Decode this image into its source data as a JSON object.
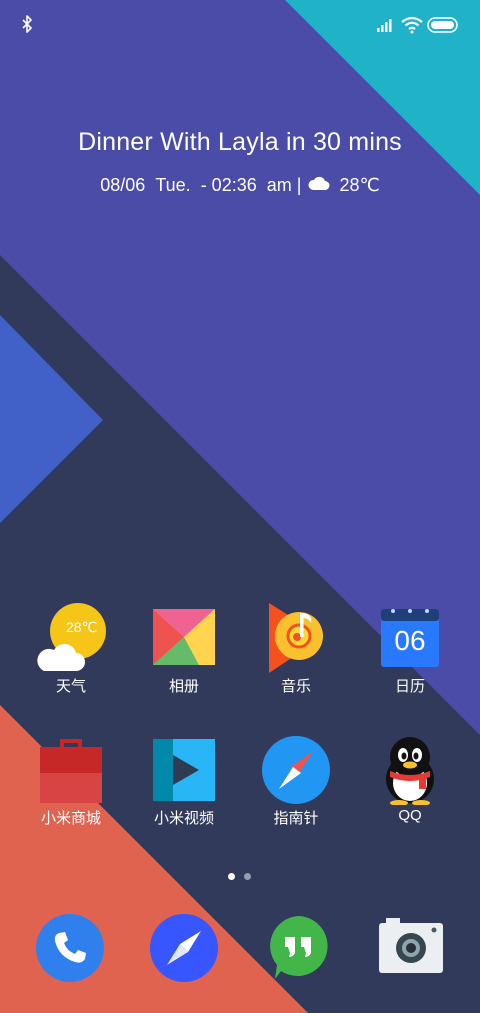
{
  "status_bar": {
    "left_icon": "bluetooth-icon",
    "right_icons": [
      "signal-icon",
      "wifi-icon",
      "battery-icon"
    ]
  },
  "widget": {
    "event": "Dinner With Layla in 30 mins",
    "date": "08/06",
    "weekday": "Tue.",
    "time": "- 02:36",
    "ampm": "am",
    "separator": "|",
    "weather_icon": "cloud-icon",
    "temperature": "28℃"
  },
  "apps": [
    {
      "label": "天气",
      "icon": "weather-icon",
      "badge_text": "28℃"
    },
    {
      "label": "相册",
      "icon": "gallery-icon"
    },
    {
      "label": "音乐",
      "icon": "music-icon"
    },
    {
      "label": "日历",
      "icon": "calendar-icon",
      "badge_text": "06"
    },
    {
      "label": "小米商城",
      "icon": "mi-store-icon"
    },
    {
      "label": "小米视频",
      "icon": "mi-video-icon"
    },
    {
      "label": "指南针",
      "icon": "compass-icon"
    },
    {
      "label": "QQ",
      "icon": "qq-penguin-icon"
    }
  ],
  "page_indicator": {
    "pages": 2,
    "current": 1
  },
  "dock": [
    {
      "name": "phone",
      "icon": "phone-icon"
    },
    {
      "name": "browser",
      "icon": "browser-compass-icon"
    },
    {
      "name": "messages",
      "icon": "messages-icon"
    },
    {
      "name": "camera",
      "icon": "camera-icon"
    }
  ],
  "colors": {
    "wallpaper_purple": "#4a4ca8",
    "wallpaper_teal": "#1fb2c8",
    "wallpaper_navy": "#313a5a",
    "wallpaper_blue": "#4160c8",
    "wallpaper_coral": "#e06350"
  }
}
